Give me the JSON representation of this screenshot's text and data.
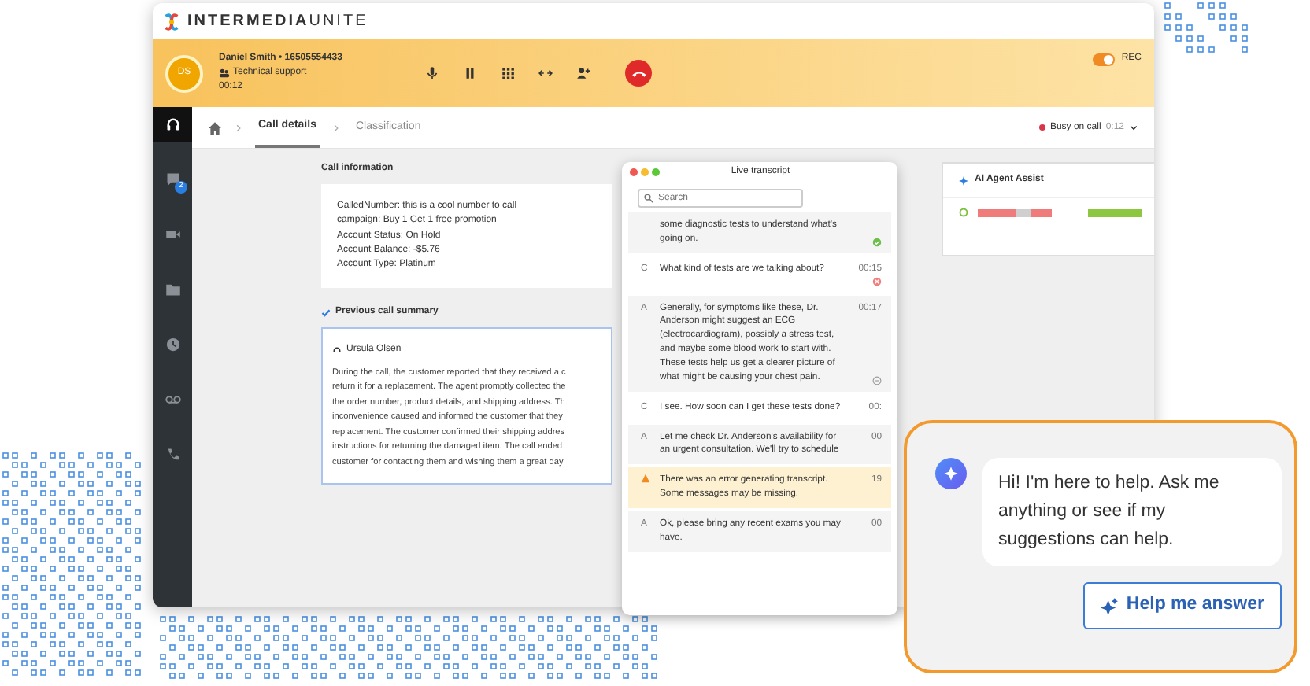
{
  "logo": {
    "brand": "INTERMEDIA",
    "product": "UNITE"
  },
  "call_header": {
    "avatar": "DS",
    "caller": "Daniel Smith • 16505554433",
    "queue": "Technical support",
    "timer": "00:12",
    "recording": {
      "label": "REC",
      "on": true
    }
  },
  "breadcrumbs": [
    {
      "label": "Call details",
      "selected": true
    },
    {
      "label": "Classification",
      "selected": false
    }
  ],
  "presence": {
    "label": "Busy on call",
    "timer": "0:12",
    "color": "#d9364a"
  },
  "sidebar": [
    {
      "kind": "headset",
      "selected": true
    },
    {
      "kind": "chat",
      "selected": false,
      "badge": "2"
    },
    {
      "kind": "video",
      "selected": false
    },
    {
      "kind": "folder",
      "selected": false
    },
    {
      "kind": "clock",
      "selected": false
    },
    {
      "kind": "voicemail",
      "selected": false
    },
    {
      "kind": "phone",
      "selected": false
    }
  ],
  "call_information": {
    "title": "Call information",
    "lines": [
      "CalledNumber: this is a cool number to call",
      "campaign: Buy 1 Get 1 free promotion",
      "Account Status: On Hold",
      "Account Balance: -$5.76",
      "Account Type: Platinum"
    ]
  },
  "previous_summary": {
    "title": "Previous call summary",
    "agent": "Ursula Olsen",
    "lines": [
      "During the call, the customer reported that they received a c",
      "return it for a replacement. The agent promptly collected the",
      "the order number, product details, and shipping address. Th",
      "inconvenience caused and informed the customer that they",
      "replacement. The customer confirmed their shipping addres",
      "instructions for returning the damaged item. The call ended",
      "customer for contacting them and wishing them a great day"
    ]
  },
  "transcript": {
    "title": "Live transcript",
    "search": {
      "placeholder": "Search"
    },
    "messages": [
      {
        "kind": "ok",
        "text": "some diagnostic tests to understand what's going on."
      },
      {
        "kind": "error",
        "speaker": "C",
        "text": "What kind of tests are we talking about?",
        "time": "00:15"
      },
      {
        "kind": "pending",
        "speaker": "A",
        "text": "Generally, for symptoms like these, Dr. Anderson might suggest an ECG (electrocardiogram), possibly a stress test, and maybe some blood work to start with. These tests help us get a clearer picture of what might be causing your chest pain.",
        "time": "00:17"
      },
      {
        "kind": "plain",
        "speaker": "C",
        "text": "I see. How soon can I get these tests done?",
        "time": "00:"
      },
      {
        "kind": "plain",
        "speaker": "A",
        "text": "Let me check Dr. Anderson's availability for an urgent consultation. We'll try to schedule",
        "time": "00"
      },
      {
        "kind": "warning",
        "text": "There was an error generating transcript. Some messages may be missing.",
        "time": "19"
      },
      {
        "kind": "plain",
        "speaker": "A",
        "text": "Ok, please bring any recent exams you may have.",
        "time": "00"
      }
    ]
  },
  "agent_assist": {
    "title": "AI Agent Assist"
  },
  "assistant_popup": {
    "message": "Hi! I'm here to help. Ask me anything or see if my suggestions can help.",
    "button": "Help me answer"
  }
}
